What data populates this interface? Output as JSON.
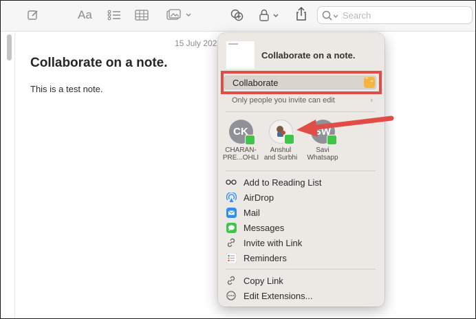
{
  "toolbar": {
    "search_placeholder": "Search",
    "format_label": "Aa"
  },
  "note": {
    "date": "15 July 202",
    "title": "Collaborate on a note.",
    "body": "This is a test note."
  },
  "share_popover": {
    "title": "Collaborate on a note.",
    "mode_select": {
      "selected": "Collaborate",
      "stepper_glyph": "⌃⌄"
    },
    "permission_text": "Only people you invite can edit",
    "permission_chevron": "›",
    "people": [
      {
        "initials": "CK",
        "name": "CHARAN-\nPRE...OHLI"
      },
      {
        "initials": "",
        "name": "Anshul\nand Surbhi"
      },
      {
        "initials": "SW",
        "name": "Savi\nWhatsapp"
      }
    ],
    "share_items": [
      {
        "label": "Add to Reading List",
        "icon": "reading-list-icon"
      },
      {
        "label": "AirDrop",
        "icon": "airdrop-icon"
      },
      {
        "label": "Mail",
        "icon": "mail-icon"
      },
      {
        "label": "Messages",
        "icon": "messages-icon"
      },
      {
        "label": "Invite with Link",
        "icon": "link-icon"
      },
      {
        "label": "Reminders",
        "icon": "reminders-icon"
      }
    ],
    "extra_items": [
      {
        "label": "Copy Link",
        "icon": "link-icon"
      },
      {
        "label": "Edit Extensions...",
        "icon": "extensions-icon"
      }
    ]
  },
  "colors": {
    "highlight": "#e14c47",
    "stepper": "#f4b53a",
    "messages_green": "#3ec64a",
    "mail_blue": "#2e8ff3"
  }
}
